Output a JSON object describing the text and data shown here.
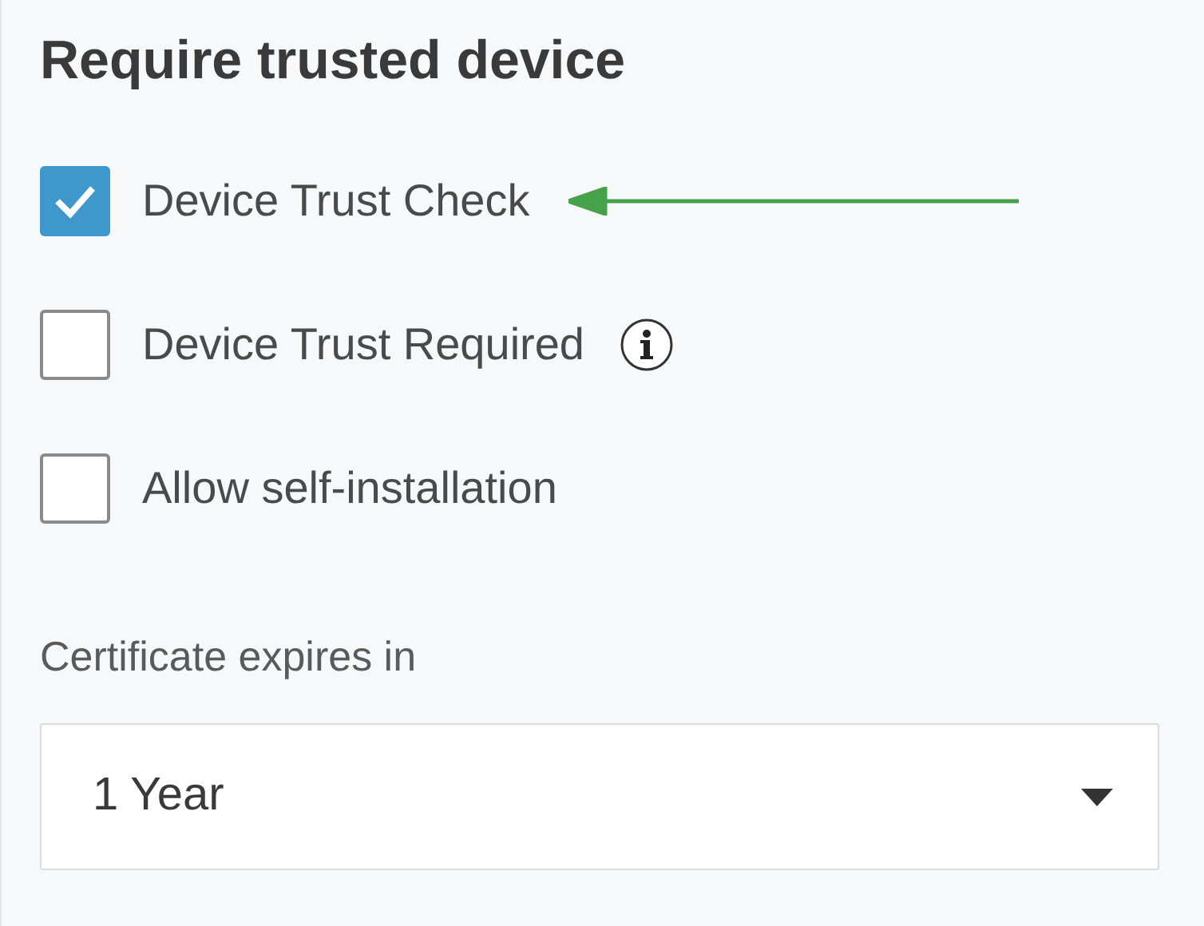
{
  "title": "Require trusted device",
  "options": [
    {
      "label": "Device Trust Check",
      "checked": true,
      "info_icon": false,
      "pointer_arrow": true
    },
    {
      "label": "Device Trust Required",
      "checked": false,
      "info_icon": true,
      "pointer_arrow": false
    },
    {
      "label": "Allow self-installation",
      "checked": false,
      "info_icon": false,
      "pointer_arrow": false
    }
  ],
  "expiry": {
    "label": "Certificate expires in",
    "value": "1 Year"
  }
}
